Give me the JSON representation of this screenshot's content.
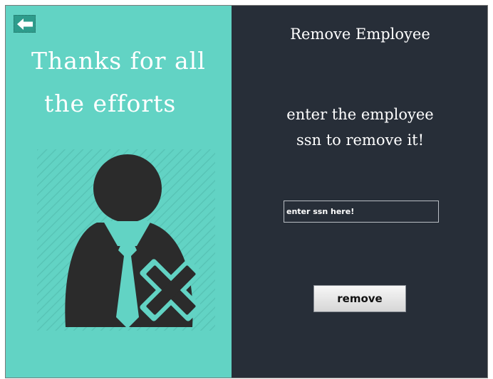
{
  "left_panel": {
    "thanks_line_1": "Thanks for all",
    "thanks_line_2": "the efforts",
    "back_icon": "arrow-left-icon",
    "illustration_icon": "remove-user-icon"
  },
  "right_panel": {
    "title": "Remove Employee",
    "instruction_line_1": "enter the employee",
    "instruction_line_2": "ssn to remove it!",
    "ssn_input": {
      "value": "",
      "placeholder": "enter ssn here!"
    },
    "remove_label": "remove"
  },
  "colors": {
    "left_background": "#62d3c4",
    "right_background": "#272e38",
    "icon_dark": "#2b2b2b",
    "text_light": "#ffffff"
  }
}
